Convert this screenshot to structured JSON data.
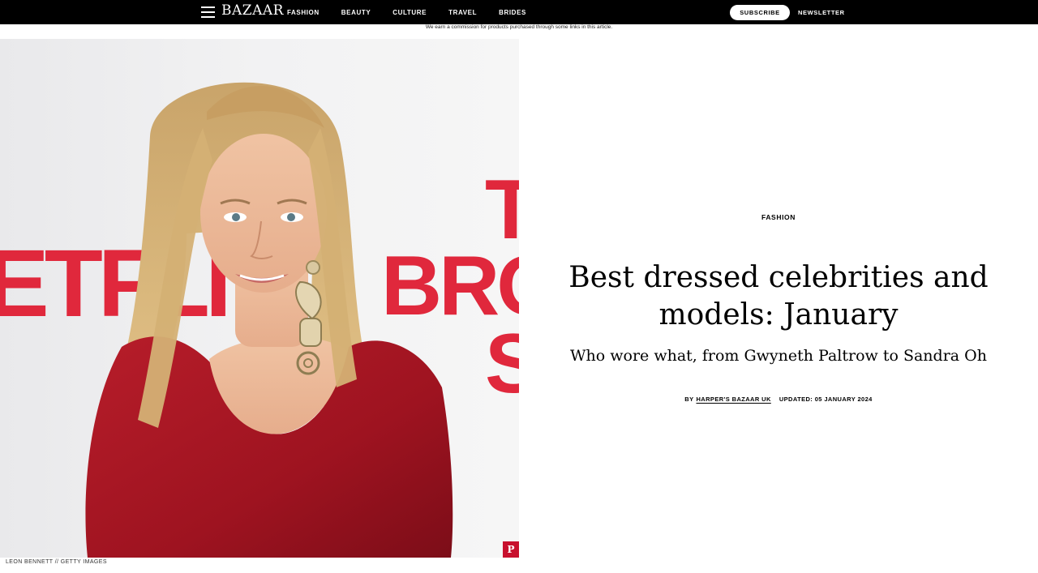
{
  "nav": {
    "logo": "BAZAAR",
    "items": [
      "FASHION",
      "BEAUTY",
      "CULTURE",
      "TRAVEL",
      "BRIDES"
    ],
    "subscribe_label": "SUBSCRIBE",
    "newsletter_label": "NEWSLETTER"
  },
  "disclaimer": "We earn a commission for products purchased through some links in this article.",
  "hero": {
    "backdrop_text_left": "ETFLI",
    "backdrop_text_right": [
      "T",
      "BRO",
      "S"
    ],
    "credit": "LEON BENNETT // GETTY IMAGES",
    "pin_icon": "pinterest-icon"
  },
  "article": {
    "category": "FASHION",
    "headline": "Best dressed celebrities and models: January",
    "dek": "Who wore what, from Gwyneth Paltrow to Sandra Oh",
    "by_prefix": "BY",
    "author": "HARPER'S BAZAAR UK",
    "updated": "UPDATED: 05 JANUARY 2024"
  },
  "colors": {
    "topbar": "#000000",
    "backdrop_red": "#e0283c",
    "dress_red": "#a3141f"
  }
}
